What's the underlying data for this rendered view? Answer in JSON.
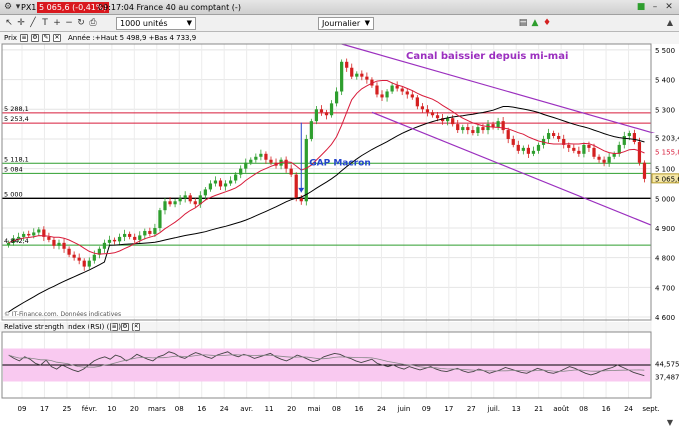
{
  "titlebar": {
    "instrument": "PX1",
    "change": "5 065,6 (-0,41%)",
    "info": "09:17:04 France 40 au comptant (-)"
  },
  "toolbar": {
    "units_select": "1000 unités",
    "period_select": "Journalier"
  },
  "price_panel": {
    "label": "Prix",
    "summary": "Année :+Haut 5 498,9 +Bas 4 733,9",
    "watermark": "© IT-Finance.com. Données indicatives"
  },
  "rsi_panel": {
    "label": "Relative strength index (RSI) (14)"
  },
  "colors": {
    "candle_up": "#2e9e2e",
    "candle_down": "#d42020",
    "channel": "#9b2fbf",
    "ma_short": "#d81b3a",
    "ma_long": "#000000",
    "annotation": "#9b2fbf",
    "gap_annotation": "#2244cc",
    "rsi_band": "#f9c9f0",
    "rsi_line": "#444444"
  },
  "chart_data": [
    {
      "type": "candlestick",
      "title": "",
      "y_ticks": [
        4600,
        4700,
        4800,
        4900,
        5000,
        5100,
        5200,
        5300,
        5400,
        5500
      ],
      "y_tick_labels": [
        "4 600",
        "4 700",
        "4 800",
        "4 900",
        "5 000",
        "5 100",
        "5 200",
        "5 300",
        "5 400",
        "5 500"
      ],
      "ylim": [
        4590,
        5520
      ],
      "x_tick_labels": [
        "09",
        "17",
        "25",
        "févr.",
        "10",
        "20",
        "mars",
        "08",
        "16",
        "24",
        "avr.",
        "11",
        "20",
        "mai",
        "08",
        "16",
        "24",
        "juin",
        "09",
        "17",
        "27",
        "juil.",
        "13",
        "21",
        "août",
        "08",
        "16",
        "24",
        "sept."
      ],
      "grid": true,
      "horizontal_levels": [
        {
          "value": 5288.1,
          "label": "5 288,1",
          "color": "#d81b3a"
        },
        {
          "value": 5253.4,
          "label": "5 253,4",
          "color": "#d81b3a"
        },
        {
          "value": 5118.1,
          "label": "5 118,1",
          "color": "#2e9e2e"
        },
        {
          "value": 5084,
          "label": "5 084",
          "color": "#2e9e2e"
        },
        {
          "value": 5000,
          "label": "5 000",
          "color": "#000000"
        },
        {
          "value": 4842.4,
          "label": "4 842,4",
          "color": "#2e9e2e"
        }
      ],
      "value_badges": [
        {
          "value": 5203.4,
          "label": "5 203,4",
          "style": "plain"
        },
        {
          "value": 5155.8,
          "label": "5 155,8",
          "style": "red"
        },
        {
          "value": 5065.6,
          "label": "5 065,6",
          "style": "last"
        }
      ],
      "annotations": [
        {
          "text": "Canal baissier depuis mi-mai"
        },
        {
          "text": "GAP Macron"
        }
      ],
      "closes": [
        4850,
        4865,
        4870,
        4880,
        4875,
        4885,
        4895,
        4870,
        4860,
        4840,
        4850,
        4830,
        4810,
        4800,
        4790,
        4770,
        4790,
        4810,
        4830,
        4850,
        4860,
        4855,
        4870,
        4880,
        4870,
        4860,
        4875,
        4890,
        4880,
        4900,
        4960,
        4990,
        4980,
        4990,
        5000,
        5010,
        4990,
        4980,
        5010,
        5030,
        5050,
        5060,
        5040,
        5050,
        5060,
        5080,
        5100,
        5120,
        5130,
        5140,
        5150,
        5130,
        5120,
        5110,
        5130,
        5100,
        5080,
        5000,
        4990,
        5200,
        5260,
        5300,
        5290,
        5280,
        5320,
        5360,
        5460,
        5440,
        5410,
        5420,
        5410,
        5400,
        5380,
        5350,
        5340,
        5360,
        5380,
        5370,
        5360,
        5350,
        5340,
        5310,
        5300,
        5290,
        5280,
        5270,
        5260,
        5270,
        5250,
        5230,
        5240,
        5230,
        5220,
        5240,
        5230,
        5250,
        5240,
        5260,
        5230,
        5200,
        5180,
        5160,
        5170,
        5150,
        5160,
        5180,
        5200,
        5220,
        5210,
        5200,
        5180,
        5170,
        5160,
        5150,
        5180,
        5170,
        5140,
        5130,
        5120,
        5140,
        5150,
        5180,
        5210,
        5220,
        5190,
        5120,
        5065.6
      ],
      "series": [
        {
          "name": "",
          "role": "short moving average"
        },
        {
          "name": "",
          "role": "long moving average"
        }
      ]
    },
    {
      "type": "line",
      "title": "",
      "y_tick_labels": [
        "44,575",
        "37,487"
      ],
      "values": [
        62,
        58,
        55,
        60,
        57,
        52,
        50,
        56,
        48,
        45,
        50,
        47,
        44,
        42,
        45,
        50,
        55,
        58,
        60,
        57,
        62,
        60,
        55,
        58,
        63,
        60,
        57,
        55,
        60,
        62,
        66,
        64,
        60,
        58,
        62,
        65,
        63,
        60,
        58,
        62,
        64,
        66,
        62,
        60,
        63,
        61,
        58,
        60,
        62,
        64,
        60,
        57,
        55,
        58,
        62,
        60,
        57,
        54,
        56,
        60,
        62,
        64,
        63,
        60,
        58,
        55,
        53,
        55,
        57,
        52,
        50,
        48,
        50,
        47,
        45,
        48,
        46,
        44,
        46,
        48,
        45,
        43,
        42,
        44,
        46,
        43,
        41,
        42,
        45,
        43,
        40,
        42,
        44,
        47,
        45,
        43,
        41,
        40,
        43,
        46,
        44,
        41,
        40,
        42,
        45,
        48,
        46,
        43,
        40,
        38,
        40,
        43,
        45,
        47,
        50,
        47,
        44,
        41,
        39,
        37
      ],
      "band": [
        30,
        70
      ]
    }
  ]
}
